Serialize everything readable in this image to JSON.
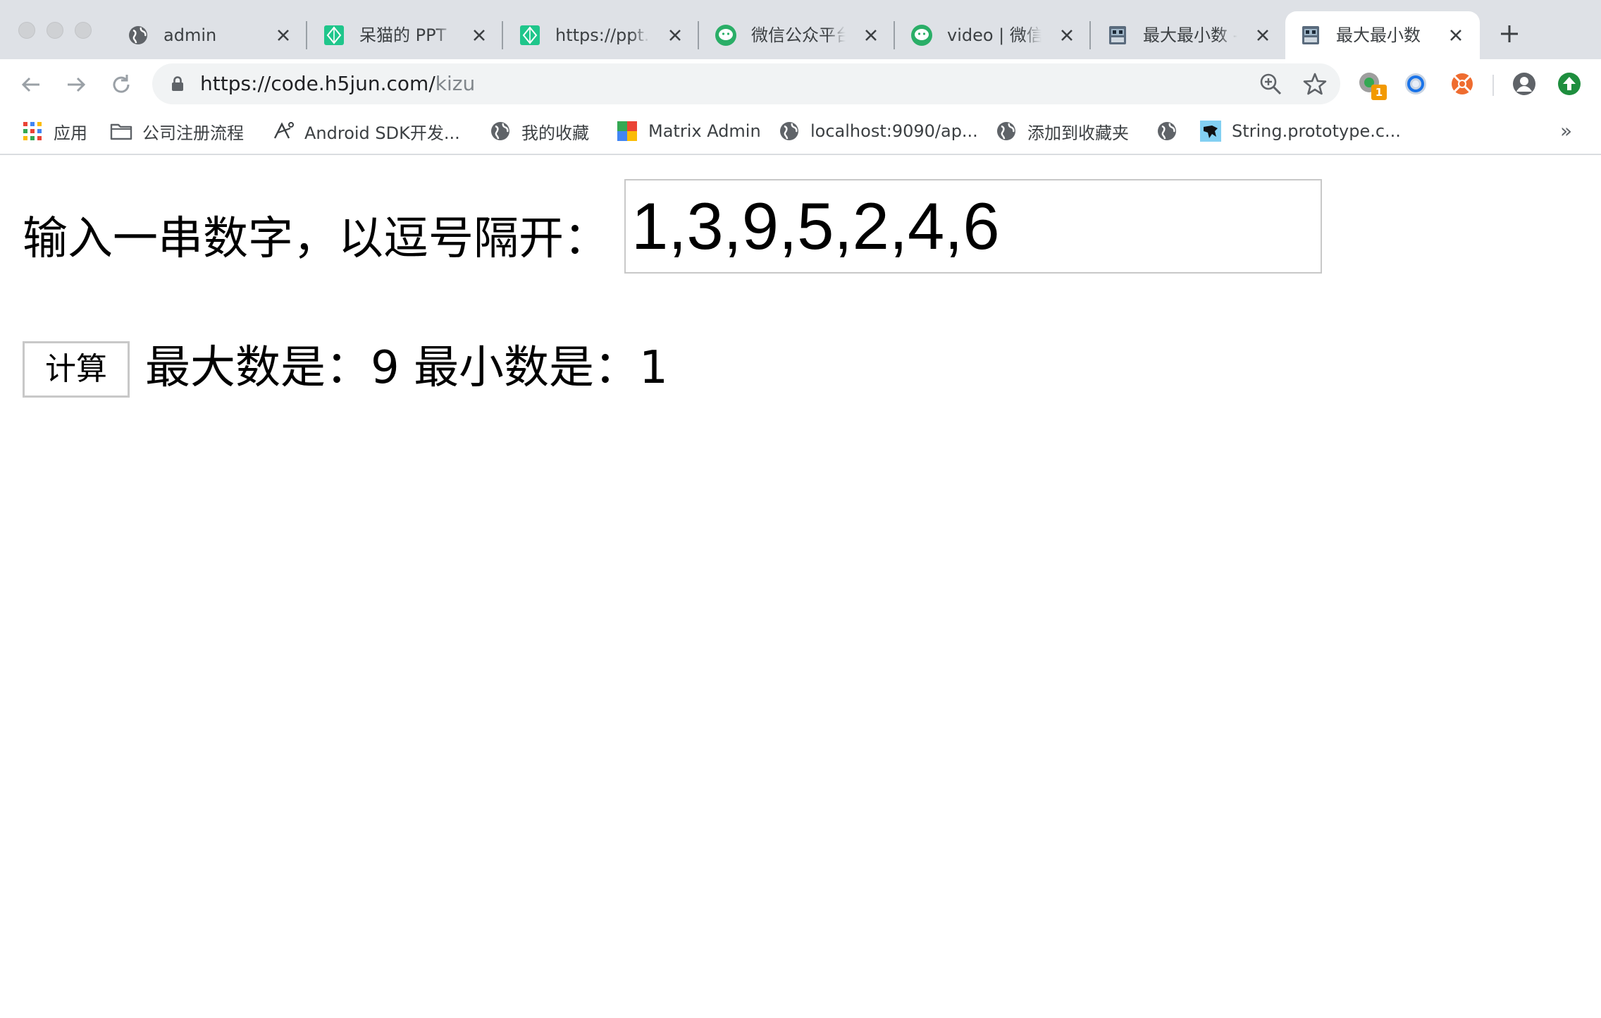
{
  "browser": {
    "tabs": [
      {
        "title": "admin",
        "favicon": "globe-icon",
        "active": false
      },
      {
        "title": "呆猫的 PPT",
        "favicon": "ppt-green-icon",
        "active": false
      },
      {
        "title": "https://ppt.ba",
        "favicon": "ppt-green-icon",
        "active": false
      },
      {
        "title": "微信公众平台",
        "favicon": "wechat-icon",
        "active": false
      },
      {
        "title": "video | 微信开",
        "favicon": "wechat-icon",
        "active": false
      },
      {
        "title": "最大最小数 -",
        "favicon": "codepen-robot-icon",
        "active": false
      },
      {
        "title": "最大最小数",
        "favicon": "codepen-robot-icon",
        "active": true
      }
    ],
    "address": {
      "host": "https://code.h5jun.com/",
      "path": "kizu"
    },
    "extension_badge": "1",
    "bookmarks": [
      {
        "label": "应用",
        "icon": "apps-grid-icon"
      },
      {
        "label": "公司注册流程",
        "icon": "folder-icon"
      },
      {
        "label": "Android SDK开发...",
        "icon": "android-sdk-icon"
      },
      {
        "label": "我的收藏",
        "icon": "globe-icon"
      },
      {
        "label": "Matrix Admin",
        "icon": "matrix-admin-icon"
      },
      {
        "label": "localhost:9090/ap...",
        "icon": "globe-icon"
      },
      {
        "label": "添加到收藏夹",
        "icon": "globe-icon"
      },
      {
        "label": "",
        "icon": "globe-icon"
      },
      {
        "label": "String.prototype.c...",
        "icon": "mdn-dino-icon"
      }
    ],
    "bookmarks_more": "»"
  },
  "page": {
    "prompt": "输入一串数字，以逗号隔开：",
    "input_value": "1,3,9,5,2,4,6",
    "button_label": "计算",
    "max_label": "最大数是：",
    "max_value": "9",
    "min_label": "最小数是：",
    "min_value": "1"
  },
  "colors": {
    "tabstrip_bg": "#dee1e6",
    "omnibox_bg": "#f1f3f4",
    "wechat_green": "#2aae67",
    "ppt_green": "#1fc68b"
  }
}
